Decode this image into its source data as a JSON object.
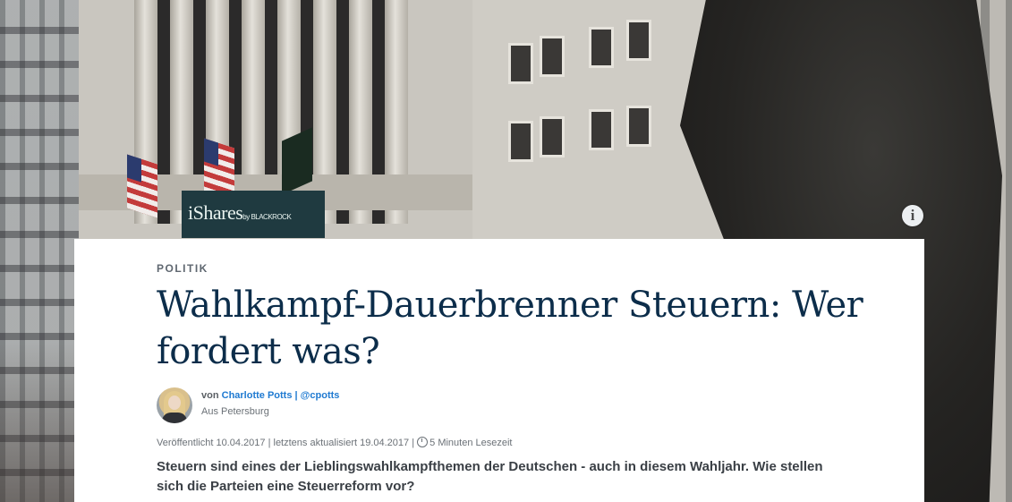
{
  "hero": {
    "banner_text": "iShares",
    "banner_sub": "by BLACKROCK",
    "info_icon": "info-icon"
  },
  "article": {
    "kicker": "POLITIK",
    "headline": "Wahlkampf-Dauerbrenner Steuern: Wer fordert was?",
    "author": {
      "prefix": "von",
      "name": "Charlotte Potts",
      "separator": "|",
      "handle": "@cpotts",
      "location": "Aus Petersburg"
    },
    "meta": {
      "published": "Veröffentlicht 10.04.2017",
      "separator": "|",
      "updated": "letztens aktualisiert 19.04.2017",
      "separator2": "|",
      "read_time": "5 Minuten Lesezeit"
    },
    "lead": "Steuern sind eines der Lieblingswahlkampfthemen der Deutschen - auch in diesem Wahljahr. Wie stellen sich die Parteien eine Steuerreform vor?"
  }
}
